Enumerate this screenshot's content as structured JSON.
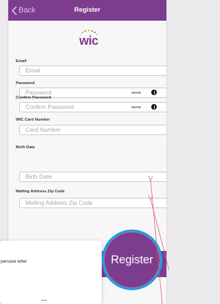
{
  "navbar": {
    "back_label": "Back",
    "title": "Register"
  },
  "logo": {
    "text": "wic"
  },
  "form": {
    "email": {
      "label": "Email",
      "placeholder": "Email"
    },
    "password": {
      "label": "Password",
      "placeholder": "Password",
      "show_label": "SHOW"
    },
    "confirm_password": {
      "label": "Confirm Password",
      "placeholder": "Confirm Password",
      "show_label": "SHOW"
    },
    "card_number": {
      "label": "WIC Card Number",
      "placeholder": "Card Number"
    },
    "birth_date": {
      "label": "Birth Date",
      "placeholder": "Birth Date"
    },
    "zip_code": {
      "label": "Mailing Address Zip Code",
      "placeholder": "Mailing Address Zip Code"
    }
  },
  "register_button": {
    "label": "Register"
  },
  "popup": {
    "text": "percase letter"
  },
  "colors": {
    "brand_purple": "#7c3d8e",
    "callout_blue": "#1d9ee0",
    "arrow_pink": "#e35a6c",
    "logo_green": "#6cb33f"
  },
  "icons": {
    "back": "chevron-left-icon",
    "info": "info-circle-icon"
  }
}
